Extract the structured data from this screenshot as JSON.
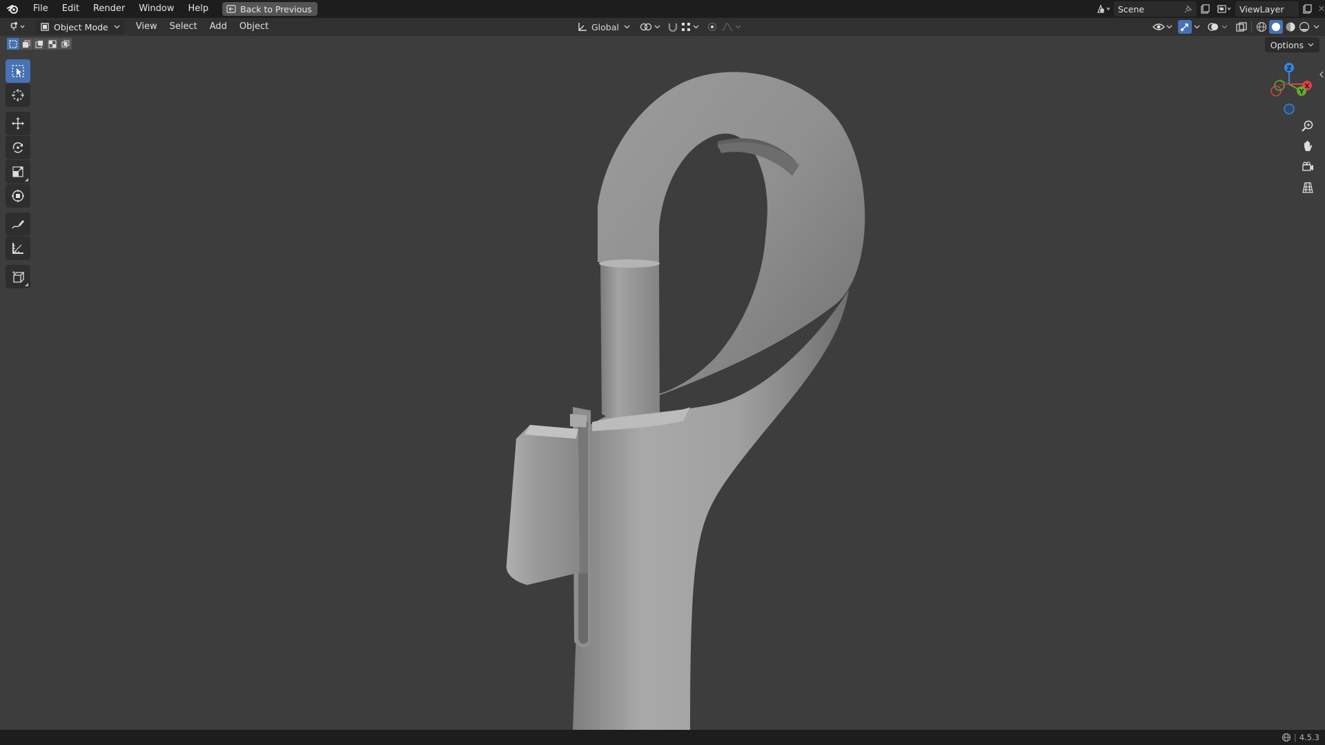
{
  "topbar": {
    "menu": [
      "File",
      "Edit",
      "Render",
      "Window",
      "Help"
    ],
    "back_button": "Back to Previous",
    "scene_name": "Scene",
    "view_layer": "ViewLayer"
  },
  "header": {
    "mode": "Object Mode",
    "menus": [
      "View",
      "Select",
      "Add",
      "Object"
    ],
    "orientation": "Global",
    "options_label": "Options"
  },
  "gizmo": {
    "axes": [
      "X",
      "Y",
      "Z"
    ],
    "colors": {
      "x": "#e0404a",
      "y": "#6aa533",
      "z": "#3d84d8"
    }
  },
  "status": {
    "version": "4.5.3"
  },
  "theme": {
    "accent": "#4772b3",
    "viewport_bg": "#3d3d3d"
  }
}
